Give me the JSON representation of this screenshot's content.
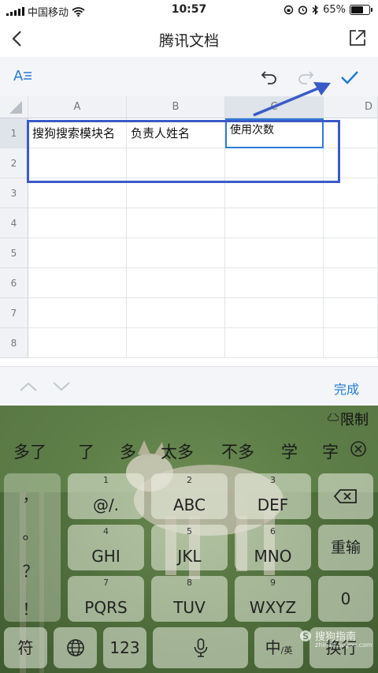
{
  "status_bar": {
    "carrier": "中国移动",
    "time": "10:57",
    "battery": "65%"
  },
  "titlebar": {
    "title": "腾讯文档"
  },
  "toolbar": {
    "format_icon_text": "A"
  },
  "sheet": {
    "columns": [
      "A",
      "B",
      "C",
      "D"
    ],
    "rows": [
      "1",
      "2",
      "3",
      "4",
      "5",
      "6",
      "7",
      "8"
    ],
    "cells": {
      "A1": "搜狗搜索模块名",
      "B1": "负责人姓名",
      "C1": "使用次数"
    }
  },
  "keyboard_nav": {
    "done_label": "完成"
  },
  "keyboard": {
    "limit_label": "限制",
    "candidates": [
      "多了",
      "了",
      "多",
      "太多",
      "不多",
      "学",
      "字"
    ],
    "punctuation": [
      "，",
      "。",
      "？",
      "！"
    ],
    "keys": [
      {
        "num": "1",
        "label": "@/."
      },
      {
        "num": "2",
        "label": "ABC"
      },
      {
        "num": "3",
        "label": "DEF"
      },
      {
        "num": "4",
        "label": "GHI"
      },
      {
        "num": "5",
        "label": "JKL"
      },
      {
        "num": "6",
        "label": "MNO"
      },
      {
        "num": "7",
        "label": "PQRS"
      },
      {
        "num": "8",
        "label": "TUV"
      },
      {
        "num": "9",
        "label": "WXYZ"
      }
    ],
    "reinput_label": "重输",
    "zero_label": "0",
    "symbol_label": "符",
    "num_label": "123",
    "lang_label_main": "中",
    "lang_label_sub": "/英",
    "enter_label": "换行"
  },
  "watermark": {
    "text": "搜狗指南",
    "sub": "zhinan.sogou.com"
  },
  "colors": {
    "accent": "#1f7ad8",
    "annotation": "#3a5bc7"
  }
}
